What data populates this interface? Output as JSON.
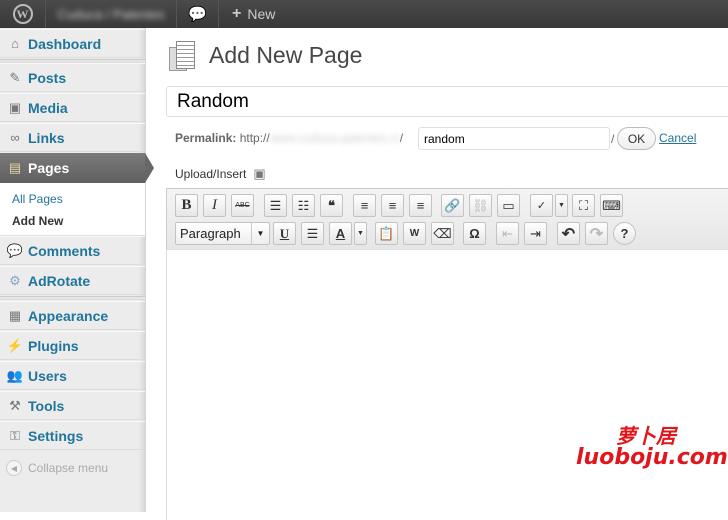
{
  "admin_bar": {
    "site_name": "Cuduca / Patentes",
    "new_label": "New",
    "icons": [
      "wordpress-logo",
      "comment-bubble",
      "plus"
    ]
  },
  "sidebar": {
    "items": [
      {
        "label": "Dashboard",
        "icon": "home"
      },
      {
        "label": "Posts",
        "icon": "pushpin"
      },
      {
        "label": "Media",
        "icon": "media"
      },
      {
        "label": "Links",
        "icon": "link"
      },
      {
        "label": "Pages",
        "icon": "pages",
        "active": true
      },
      {
        "label": "Comments",
        "icon": "speech-bubble"
      },
      {
        "label": "AdRotate",
        "icon": "gear"
      },
      {
        "label": "Appearance",
        "icon": "appearance"
      },
      {
        "label": "Plugins",
        "icon": "plug"
      },
      {
        "label": "Users",
        "icon": "users"
      },
      {
        "label": "Tools",
        "icon": "tools"
      },
      {
        "label": "Settings",
        "icon": "settings"
      }
    ],
    "submenu": [
      "All Pages",
      "Add New"
    ],
    "collapse_label": "Collapse menu"
  },
  "page": {
    "title": "Add New Page",
    "post_title": "Random",
    "permalink_label": "Permalink:",
    "permalink_prefix": "http://",
    "permalink_domain": "www.cuduca-patentes.com",
    "permalink_slug": "random",
    "slash": "/",
    "ok_label": "OK",
    "cancel_label": "Cancel",
    "upload_label": "Upload/Insert"
  },
  "toolbar": {
    "format_select": "Paragraph"
  },
  "watermark": {
    "cn": "萝卜居",
    "en": "luoboju.com",
    "color": "#e0161c"
  },
  "colors": {
    "link": "#21759b",
    "admin_bar": "#464646"
  }
}
